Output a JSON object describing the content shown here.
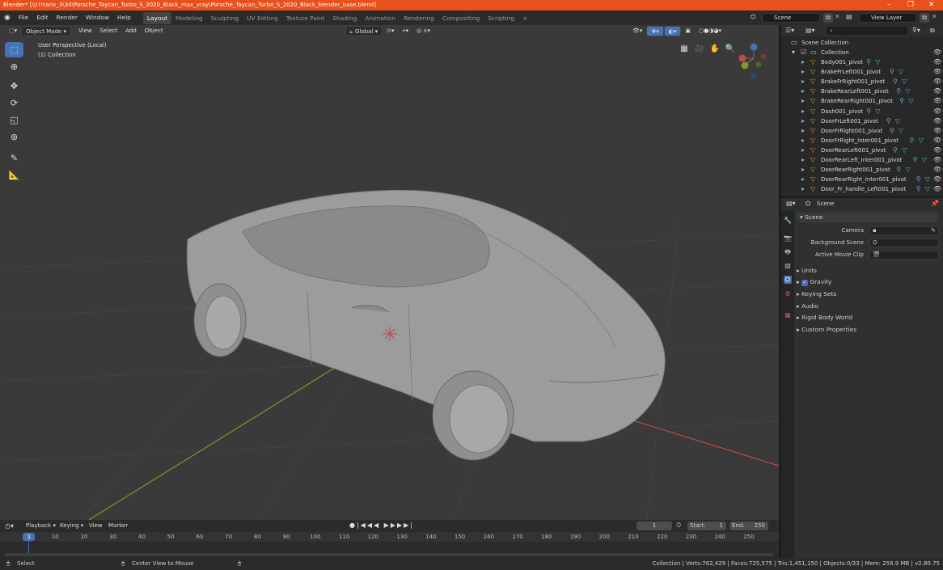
{
  "titlebar": {
    "title": "Blender* [\\\\!!!conv_3\\34\\Porsche_Taycan_Turbo_S_2020_Black_max_vray\\Porsche_Taycan_Turbo_S_2020_Black_blender_base.blend]",
    "min": "–",
    "max": "❐",
    "close": "✕"
  },
  "menu": [
    "File",
    "Edit",
    "Render",
    "Window",
    "Help"
  ],
  "workspaces": [
    "Layout",
    "Modeling",
    "Sculpting",
    "UV Editing",
    "Texture Paint",
    "Shading",
    "Animation",
    "Rendering",
    "Compositing",
    "Scripting"
  ],
  "workspace_add": "+",
  "scene_field": "Scene",
  "viewlayer_field": "View Layer",
  "viewport_header": {
    "mode": "Object Mode",
    "menus": [
      "View",
      "Select",
      "Add",
      "Object"
    ],
    "orientation": "Global"
  },
  "viewport_overlay": {
    "line1": "User Perspective (Local)",
    "line2": "(1) Collection"
  },
  "outliner": {
    "root": "Scene Collection",
    "collection": "Collection",
    "items": [
      "Body001_pivot",
      "BrakeFrLeft001_pivot",
      "BrakeFrRight001_pivot",
      "BrakeRearLeft001_pivot",
      "BrakeRearRight001_pivot",
      "Dash001_pivot",
      "DoorFrLeft001_pivot",
      "DoorFrRight001_pivot",
      "DoorFrRight_Inter001_pivot",
      "DoorRearLeft001_pivot",
      "DoorRearLeft_Inter001_pivot",
      "DoorRearRight001_pivot",
      "DoorRearRight_Inter001_pivot",
      "Door_Fr_handle_Left001_pivot"
    ]
  },
  "properties": {
    "context": "Scene",
    "panel": "Scene",
    "camera_label": "Camera",
    "bg_label": "Background Scene",
    "clip_label": "Active Movie Clip",
    "sections": [
      "Units",
      "Gravity",
      "Keying Sets",
      "Audio",
      "Rigid Body World",
      "Custom Properties"
    ]
  },
  "timeline": {
    "menus": [
      "Playback",
      "Keying",
      "View",
      "Marker"
    ],
    "current_frame": "1",
    "start_label": "Start:",
    "start": "1",
    "end_label": "End:",
    "end": "250",
    "ticks": [
      "1",
      "10",
      "20",
      "30",
      "40",
      "50",
      "60",
      "70",
      "80",
      "90",
      "100",
      "110",
      "120",
      "130",
      "140",
      "150",
      "160",
      "170",
      "180",
      "190",
      "200",
      "210",
      "220",
      "230",
      "240",
      "250"
    ]
  },
  "statusbar": {
    "select": "Select",
    "center": "Center View to Mouse",
    "stats": "Collection | Verts:762,429 | Faces:725,575 | Tris:1,451,150 | Objects:0/33 | Mem: 256.9 MB | v2.80.75"
  },
  "colors": {
    "accent": "#4772b3",
    "title": "#e8501c",
    "xaxis": "#c04848",
    "yaxis": "#7a9a2a"
  }
}
